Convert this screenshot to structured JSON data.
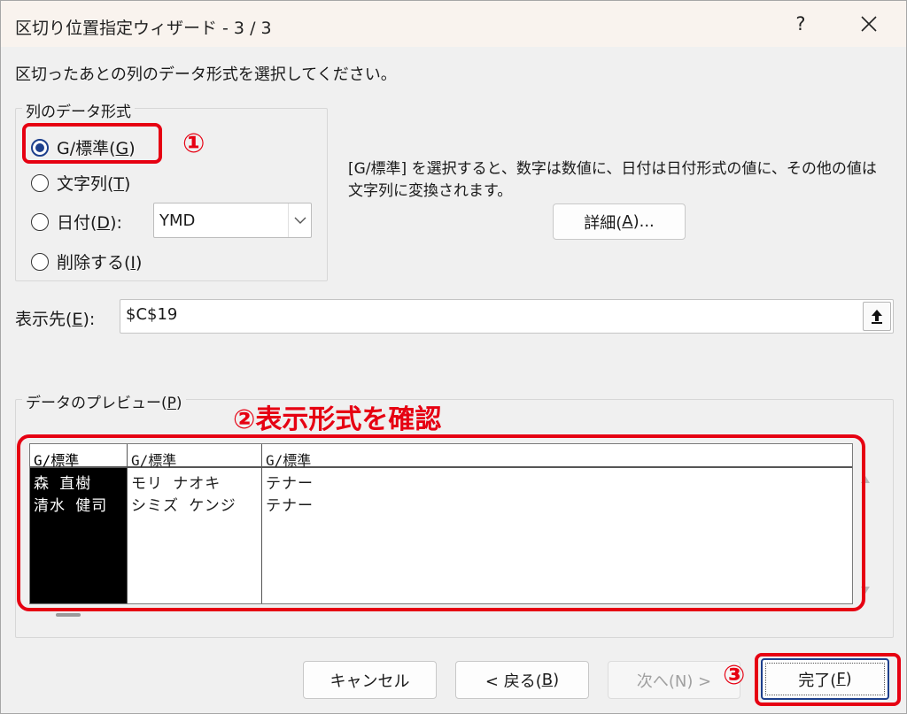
{
  "window": {
    "title": "区切り位置指定ウィザード - 3 / 3",
    "help_label": "?"
  },
  "instruction": "区切ったあとの列のデータ形式を選択してください。",
  "format_group": {
    "legend": "列のデータ形式",
    "options": [
      {
        "label": "G/標準(",
        "accel": "G",
        "suffix": ")",
        "selected": true
      },
      {
        "label": "文字列(",
        "accel": "T",
        "suffix": ")",
        "selected": false
      },
      {
        "label": "日付(",
        "accel": "D",
        "suffix": "):",
        "selected": false
      },
      {
        "label": "削除する(",
        "accel": "I",
        "suffix": ")",
        "selected": false
      }
    ],
    "date_format": "YMD"
  },
  "description": "[G/標準] を選択すると、数字は数値に、日付は日付形式の値に、その他の値は文字列に変換されます。",
  "detail_button": {
    "label": "詳細(",
    "accel": "A",
    "suffix": ")..."
  },
  "destination": {
    "label": "表示先(",
    "accel": "E",
    "suffix": "):",
    "value": "$C$19"
  },
  "preview": {
    "legend": "データのプレビュー(",
    "accel": "P",
    "suffix": ")",
    "columns": [
      {
        "header": "G/標準",
        "cells": [
          "森 直樹",
          "清水 健司"
        ],
        "selected": true
      },
      {
        "header": "G/標準",
        "cells": [
          "モリ ナオキ",
          "シミズ ケンジ"
        ],
        "selected": false
      },
      {
        "header": "G/標準",
        "cells": [
          "テナー",
          "テナー"
        ],
        "selected": false
      }
    ]
  },
  "buttons": {
    "cancel": "キャンセル",
    "back": {
      "label": "< 戻る(",
      "accel": "B",
      "suffix": ")"
    },
    "next": "次へ(N) >",
    "finish": {
      "label": "完了(",
      "accel": "F",
      "suffix": ")"
    }
  },
  "annotations": {
    "step1": "①",
    "step2_title": "②表示形式を確認",
    "step3": "③",
    "color": "#e60012"
  }
}
